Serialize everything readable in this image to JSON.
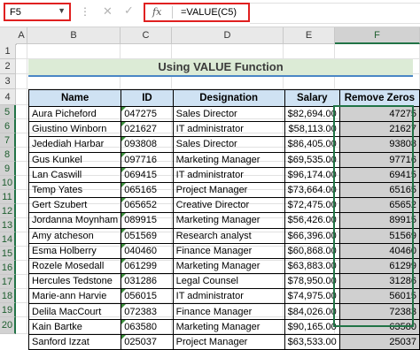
{
  "formula_bar": {
    "name_box": "F5",
    "fx_label": "fx",
    "formula": "=VALUE(C5)",
    "cancel_symbol": "✕",
    "enter_symbol": "✓"
  },
  "columns": [
    "A",
    "B",
    "C",
    "D",
    "E",
    "F"
  ],
  "selected_column": "F",
  "rows": [
    "1",
    "2",
    "3",
    "4",
    "5",
    "6",
    "7",
    "8",
    "9",
    "10",
    "11",
    "12",
    "13",
    "14",
    "15",
    "16",
    "17",
    "18",
    "19",
    "20"
  ],
  "title": "Using VALUE Function",
  "table": {
    "headers": [
      "Name",
      "ID",
      "Designation",
      "Salary",
      "Remove Zeros"
    ],
    "rows": [
      {
        "name": "Aura Picheford",
        "id": "047275",
        "designation": "Sales Director",
        "salary": "$82,694.00",
        "remove_zeros": "47275"
      },
      {
        "name": "Giustino Winborn",
        "id": "021627",
        "designation": "IT administrator",
        "salary": "$58,113.00",
        "remove_zeros": "21627"
      },
      {
        "name": "Jedediah Harbar",
        "id": "093808",
        "designation": "Sales Director",
        "salary": "$86,405.00",
        "remove_zeros": "93808"
      },
      {
        "name": "Gus Kunkel",
        "id": "097716",
        "designation": "Marketing Manager",
        "salary": "$69,535.00",
        "remove_zeros": "97716"
      },
      {
        "name": "Lan Caswill",
        "id": "069415",
        "designation": "IT administrator",
        "salary": "$96,174.00",
        "remove_zeros": "69415"
      },
      {
        "name": "Temp Yates",
        "id": "065165",
        "designation": "Project Manager",
        "salary": "$73,664.00",
        "remove_zeros": "65165"
      },
      {
        "name": "Gert Szubert",
        "id": "065652",
        "designation": "Creative Director",
        "salary": "$72,475.00",
        "remove_zeros": "65652"
      },
      {
        "name": "Jordanna Moynham",
        "id": "089915",
        "designation": "Marketing Manager",
        "salary": "$56,426.00",
        "remove_zeros": "89915"
      },
      {
        "name": "Amy atcheson",
        "id": "051569",
        "designation": "Research analyst",
        "salary": "$66,396.00",
        "remove_zeros": "51569"
      },
      {
        "name": "Esma Holberry",
        "id": "040460",
        "designation": "Finance Manager",
        "salary": "$60,868.00",
        "remove_zeros": "40460"
      },
      {
        "name": "Rozele Mosedall",
        "id": "061299",
        "designation": "Marketing Manager",
        "salary": "$63,883.00",
        "remove_zeros": "61299"
      },
      {
        "name": "Hercules Tedstone",
        "id": "031286",
        "designation": "Legal Counsel",
        "salary": "$78,950.00",
        "remove_zeros": "31286"
      },
      {
        "name": "Marie-ann Harvie",
        "id": "056015",
        "designation": "IT administrator",
        "salary": "$74,975.00",
        "remove_zeros": "56015"
      },
      {
        "name": "Delila MacCourt",
        "id": "072383",
        "designation": "Finance Manager",
        "salary": "$84,026.00",
        "remove_zeros": "72383"
      },
      {
        "name": "Kain Bartke",
        "id": "063580",
        "designation": "Marketing Manager",
        "salary": "$90,165.00",
        "remove_zeros": "63580"
      },
      {
        "name": "Sanford Izzat",
        "id": "025037",
        "designation": "Project Manager",
        "salary": "$63,533.00",
        "remove_zeros": "25037"
      }
    ]
  }
}
